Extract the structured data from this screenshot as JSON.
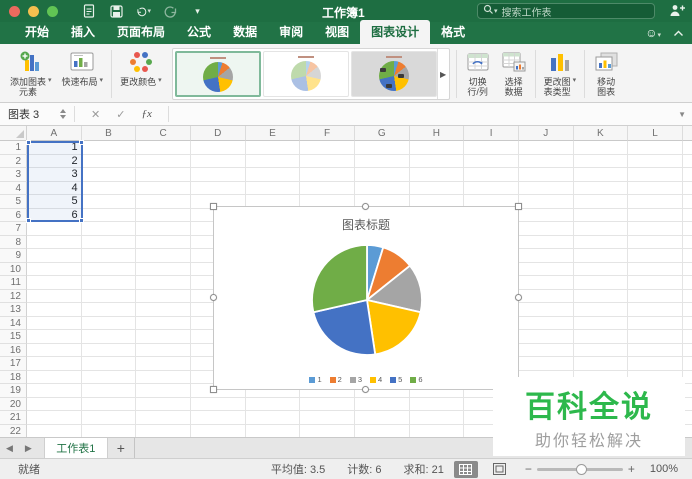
{
  "theme": {
    "brand_green": "#1E6E42",
    "tab_green": "#217346",
    "selection_blue": "#4472C4"
  },
  "titlebar": {
    "title": "工作簿1",
    "search_placeholder": "搜索工作表"
  },
  "ribbon_tabs": {
    "items": [
      "开始",
      "插入",
      "页面布局",
      "公式",
      "数据",
      "审阅",
      "视图",
      "图表设计",
      "格式"
    ],
    "active": "图表设计"
  },
  "ribbon": {
    "add_chart_element": "添加图表\n元素",
    "quick_layout": "快速布局",
    "change_colors": "更改颜色",
    "switch_row_col": "切换\n行/列",
    "select_data": "选择\n数据",
    "change_chart_type": "更改图\n表类型",
    "move_chart": "移动\n图表",
    "style_options": [
      "chart-style-1",
      "chart-style-2",
      "chart-style-3"
    ]
  },
  "formula_bar": {
    "name_box": "图表 3",
    "cancel": "✕",
    "accept": "✓",
    "insert_function": "ƒx"
  },
  "grid": {
    "columns": [
      "A",
      "B",
      "C",
      "D",
      "E",
      "F",
      "G",
      "H",
      "I",
      "J",
      "K",
      "L"
    ],
    "row_count": 22,
    "a_values": [
      "1",
      "2",
      "3",
      "4",
      "5",
      "6"
    ]
  },
  "chart_data": {
    "type": "pie",
    "title": "图表标题",
    "categories": [
      "1",
      "2",
      "3",
      "4",
      "5",
      "6"
    ],
    "values": [
      1,
      2,
      3,
      4,
      5,
      6
    ],
    "colors": [
      "#5B9BD5",
      "#ED7D31",
      "#A5A5A5",
      "#FFC000",
      "#4472C4",
      "#70AD47"
    ],
    "legend_position": "bottom"
  },
  "watermark": {
    "title": "百科全说",
    "subtitle": "助你轻松解决",
    "accent": "#2DB84C"
  },
  "sheet_bar": {
    "active_tab": "工作表1",
    "add_label": "+"
  },
  "status_bar": {
    "ready": "就绪",
    "average": "平均值: 3.5",
    "count": "计数: 6",
    "sum": "求和: 21",
    "zoom_level": "100%"
  }
}
